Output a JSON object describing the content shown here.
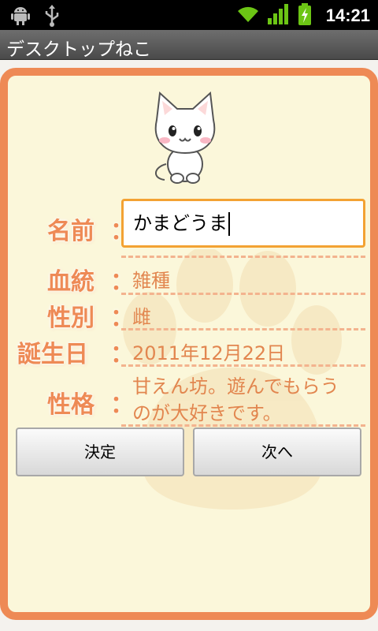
{
  "status_bar": {
    "time": "14:21",
    "icons": [
      "android-debug-icon",
      "usb-icon",
      "wifi-icon",
      "signal-icon",
      "battery-charging-icon"
    ]
  },
  "app": {
    "title": "デスクトップねこ"
  },
  "form": {
    "name": {
      "label": "名前",
      "value": "かまどうま"
    },
    "breed": {
      "label": "血統",
      "value": "雑種"
    },
    "sex": {
      "label": "性別",
      "value": "雌"
    },
    "birthday": {
      "label": "誕生日",
      "value": "2011年12月22日"
    },
    "personality": {
      "label": "性格",
      "line1": "甘えん坊。遊んでもらう",
      "line2": "のが大好きです。"
    },
    "colon": "："
  },
  "buttons": {
    "confirm": "決定",
    "next": "次へ"
  },
  "colors": {
    "accent": "#ee8a55",
    "panel_bg": "#fbf7da",
    "input_focus": "#f3a233"
  }
}
